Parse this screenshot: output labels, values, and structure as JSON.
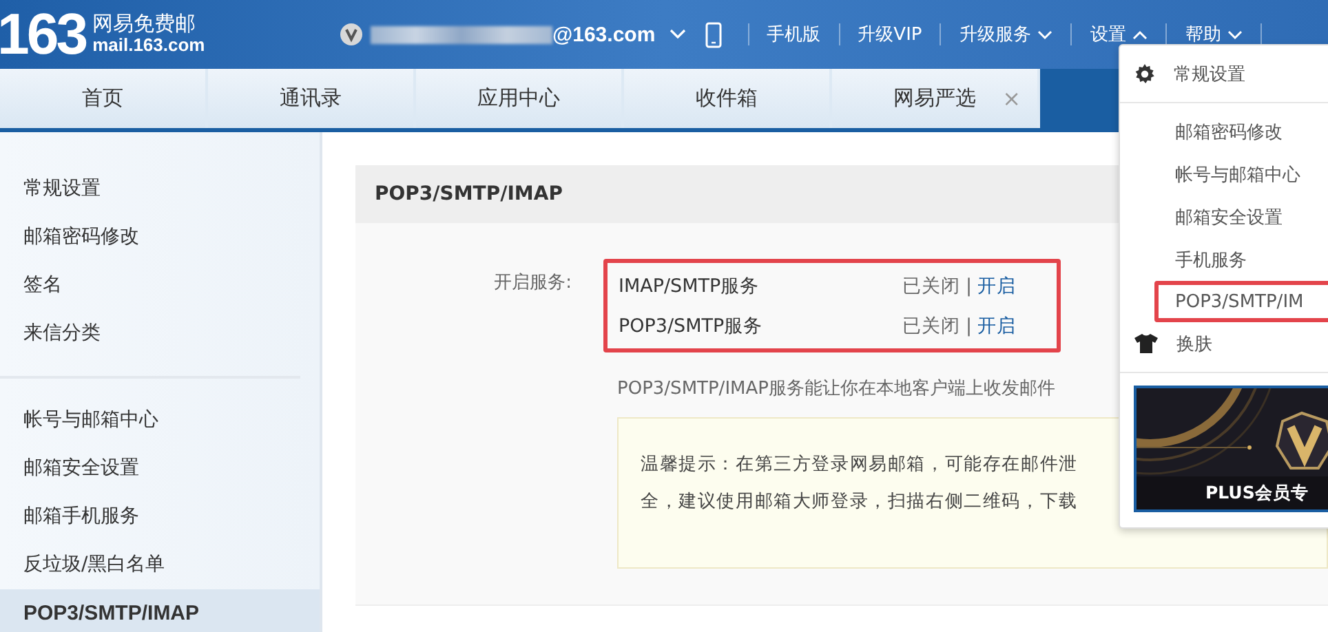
{
  "header": {
    "logo_number": "163",
    "logo_title": "网易免费邮",
    "logo_domain": "mail.163.com",
    "account": "@163.com",
    "links": [
      {
        "kind": "plain",
        "label": "手机版"
      },
      {
        "kind": "plain",
        "label": "升级VIP"
      },
      {
        "kind": "menu",
        "label": "升级服务",
        "expanded": false
      },
      {
        "kind": "menu",
        "label": "设置",
        "expanded": true
      },
      {
        "kind": "menu",
        "label": "帮助",
        "expanded": false
      }
    ]
  },
  "tabs": [
    {
      "label": "首页",
      "selected": false
    },
    {
      "label": "通讯录",
      "selected": false
    },
    {
      "label": "应用中心",
      "selected": false
    },
    {
      "label": "收件箱",
      "selected": false
    },
    {
      "label": "网易严选",
      "selected": false,
      "close": "×"
    },
    {
      "selected": true
    }
  ],
  "sidebar": {
    "groups": [
      [
        {
          "label": "常规设置",
          "selected": false
        },
        {
          "label": "邮箱密码修改",
          "selected": false
        },
        {
          "label": "签名",
          "selected": false
        },
        {
          "label": "来信分类",
          "selected": false
        }
      ],
      [
        {
          "label": "帐号与邮箱中心",
          "selected": false
        },
        {
          "label": "邮箱安全设置",
          "selected": false
        },
        {
          "label": "邮箱手机服务",
          "selected": false
        },
        {
          "label": "反垃圾/黑白名单",
          "selected": false
        },
        {
          "label": "POP3/SMTP/IMAP",
          "selected": true
        }
      ]
    ]
  },
  "panel": {
    "title": "POP3/SMTP/IMAP",
    "service_label": "开启服务:",
    "services": [
      {
        "name": "IMAP/SMTP服务",
        "status": "已关闭",
        "separator": "|",
        "action": "开启"
      },
      {
        "name": "POP3/SMTP服务",
        "status": "已关闭",
        "separator": "|",
        "action": "开启"
      }
    ],
    "description": "POP3/SMTP/IMAP服务能让你在本地客户端上收发邮件",
    "notice": [
      "温馨提示：在第三方登录网易邮箱，可能存在邮件泄",
      "全，建议使用邮箱大师登录，扫描右侧二维码，下载"
    ]
  },
  "dropdown": {
    "items": [
      {
        "kind": "gear",
        "label": "常规设置",
        "highlighted": false
      },
      {
        "kind": "divider"
      },
      {
        "kind": "plain",
        "label": "邮箱密码修改",
        "highlighted": false
      },
      {
        "kind": "plain",
        "label": "帐号与邮箱中心",
        "highlighted": false
      },
      {
        "kind": "plain",
        "label": "邮箱安全设置",
        "highlighted": false
      },
      {
        "kind": "plain",
        "label": "手机服务",
        "highlighted": false
      },
      {
        "kind": "plain",
        "label": "POP3/SMTP/IM",
        "highlighted": true
      },
      {
        "kind": "shirt",
        "label": "换肤",
        "highlighted": false
      },
      {
        "kind": "divider"
      }
    ],
    "banner": {
      "kind": "picture",
      "caption": "PLUS会员专"
    }
  }
}
